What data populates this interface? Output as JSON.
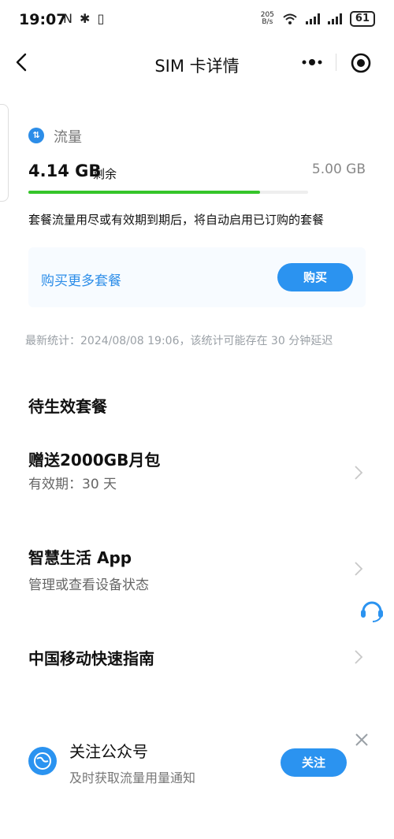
{
  "status_bar": {
    "time": "19:07",
    "left_icons": "N ✱ ▯",
    "speed_value": "205",
    "speed_unit": "B/s",
    "battery": "61"
  },
  "header": {
    "title": "SIM 卡详情"
  },
  "data_usage": {
    "label": "流量",
    "remaining_value": "4.14 GB",
    "remaining_suffix": "剩余",
    "total": "5.00 GB",
    "remaining_fraction": 0.828,
    "bar_color": "#35c52a",
    "note": "套餐流量用尽或有效期到期后，将自动启用已订购的套餐"
  },
  "buy": {
    "link_label": "购买更多套餐",
    "button_label": "购买"
  },
  "stats_text": "最新统计：2024/08/08 19:06，该统计可能存在 30 分钟延迟",
  "pending": {
    "section_title": "待生效套餐",
    "items": [
      {
        "title": "赠送2000GB月包",
        "subtitle": "有效期：30 天"
      },
      {
        "title": "智慧生活 App",
        "subtitle": "管理或查看设备状态"
      },
      {
        "title": "中国移动快速指南",
        "subtitle": ""
      }
    ]
  },
  "follow": {
    "title": "关注公众号",
    "subtitle": "及时获取流量用量通知",
    "button_label": "关注"
  },
  "colors": {
    "accent": "#2b93f0",
    "progress": "#35c52a"
  },
  "icons": [
    "back-arrow-icon",
    "more-icon",
    "target-icon",
    "flow-icon",
    "chevron-right-icon",
    "headset-icon",
    "globe-icon",
    "close-icon"
  ]
}
